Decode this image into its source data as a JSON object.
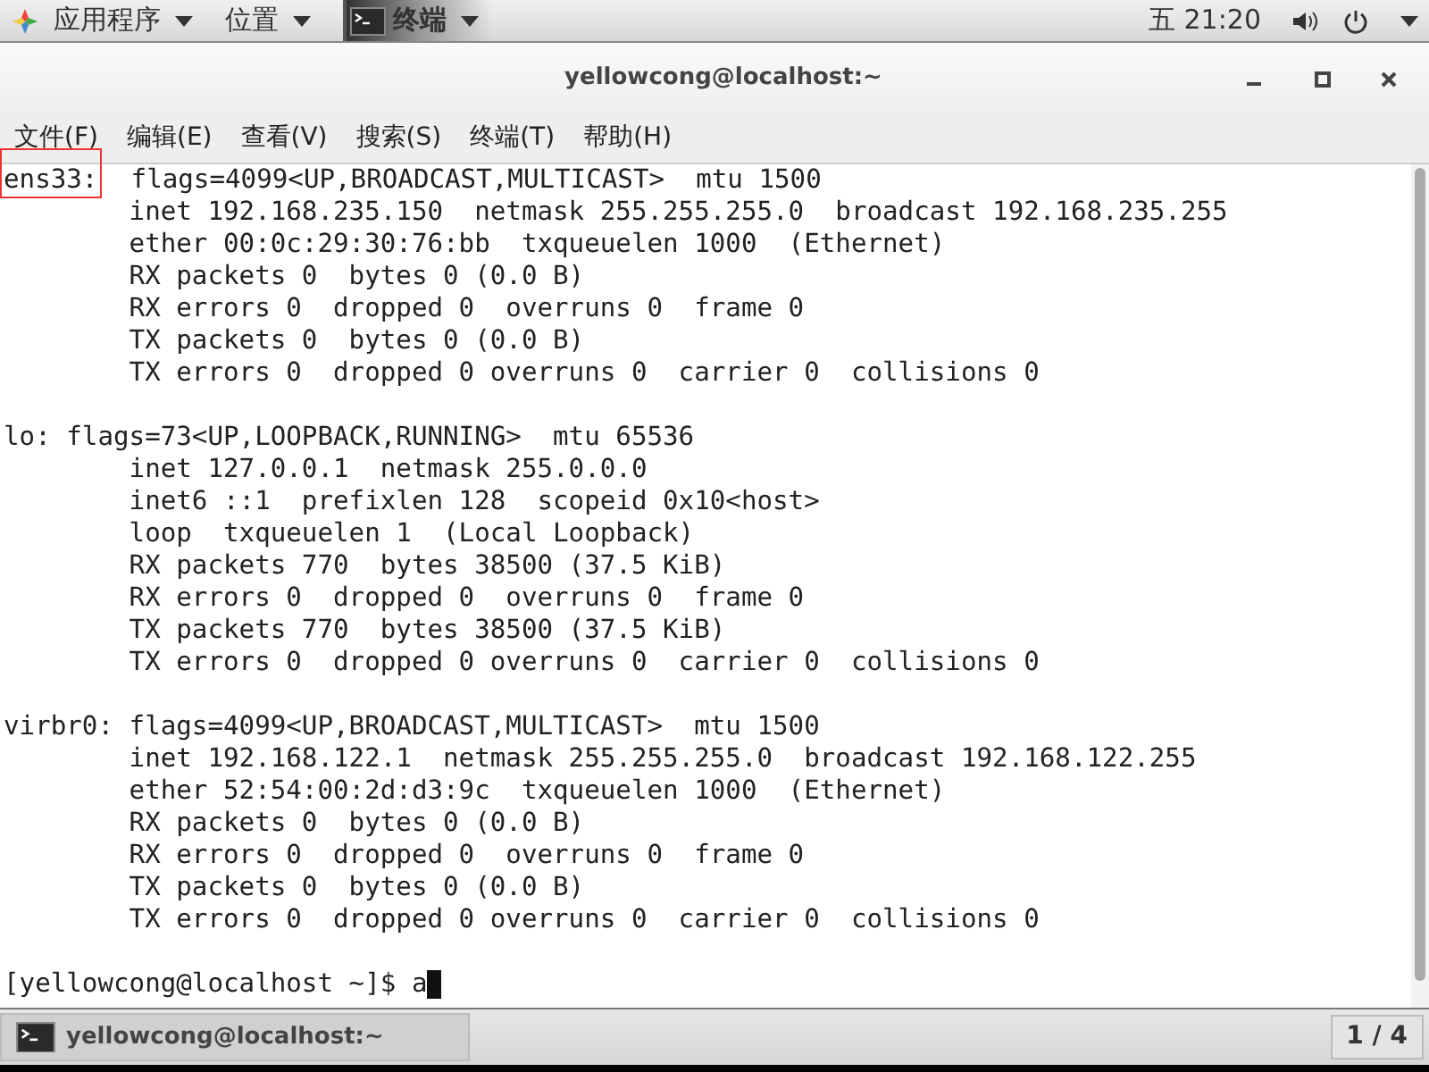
{
  "top_bar": {
    "menus": [
      {
        "label": "应用程序"
      },
      {
        "label": "位置"
      }
    ],
    "active_app": {
      "label": "终端"
    },
    "clock": "五 21:20"
  },
  "window": {
    "title": "yellowcong@localhost:~"
  },
  "menu_bar": [
    "文件(F)",
    "编辑(E)",
    "查看(V)",
    "搜索(S)",
    "终端(T)",
    "帮助(H)"
  ],
  "terminal": {
    "lines": [
      {
        "kind": "text",
        "label": "ens33:",
        "boxed": true,
        "text": "  flags=4099<UP,BROADCAST,MULTICAST>  mtu 1500"
      },
      {
        "kind": "text",
        "text": "        inet 192.168.235.150  netmask 255.255.255.0  broadcast 192.168.235.255"
      },
      {
        "kind": "text",
        "text": "        ether 00:0c:29:30:76:bb  txqueuelen 1000  (Ethernet)"
      },
      {
        "kind": "text",
        "text": "        RX packets 0  bytes 0 (0.0 B)"
      },
      {
        "kind": "text",
        "text": "        RX errors 0  dropped 0  overruns 0  frame 0"
      },
      {
        "kind": "text",
        "text": "        TX packets 0  bytes 0 (0.0 B)"
      },
      {
        "kind": "text",
        "text": "        TX errors 0  dropped 0 overruns 0  carrier 0  collisions 0"
      },
      {
        "kind": "blank"
      },
      {
        "kind": "text",
        "text": "lo: flags=73<UP,LOOPBACK,RUNNING>  mtu 65536"
      },
      {
        "kind": "text",
        "text": "        inet 127.0.0.1  netmask 255.0.0.0"
      },
      {
        "kind": "text",
        "text": "        inet6 ::1  prefixlen 128  scopeid 0x10<host>"
      },
      {
        "kind": "text",
        "text": "        loop  txqueuelen 1  (Local Loopback)"
      },
      {
        "kind": "text",
        "text": "        RX packets 770  bytes 38500 (37.5 KiB)"
      },
      {
        "kind": "text",
        "text": "        RX errors 0  dropped 0  overruns 0  frame 0"
      },
      {
        "kind": "text",
        "text": "        TX packets 770  bytes 38500 (37.5 KiB)"
      },
      {
        "kind": "text",
        "text": "        TX errors 0  dropped 0 overruns 0  carrier 0  collisions 0"
      },
      {
        "kind": "blank"
      },
      {
        "kind": "text",
        "text": "virbr0: flags=4099<UP,BROADCAST,MULTICAST>  mtu 1500"
      },
      {
        "kind": "text",
        "text": "        inet 192.168.122.1  netmask 255.255.255.0  broadcast 192.168.122.255"
      },
      {
        "kind": "text",
        "text": "        ether 52:54:00:2d:d3:9c  txqueuelen 1000  (Ethernet)"
      },
      {
        "kind": "text",
        "text": "        RX packets 0  bytes 0 (0.0 B)"
      },
      {
        "kind": "text",
        "text": "        RX errors 0  dropped 0  overruns 0  frame 0"
      },
      {
        "kind": "text",
        "text": "        TX packets 0  bytes 0 (0.0 B)"
      },
      {
        "kind": "text",
        "text": "        TX errors 0  dropped 0 overruns 0  carrier 0  collisions 0"
      },
      {
        "kind": "blank"
      },
      {
        "kind": "prompt",
        "text": "[yellowcong@localhost ~]$ a",
        "cursor": true
      }
    ]
  },
  "taskbar": {
    "windows": [
      {
        "label": "yellowcong@localhost:~",
        "selected": false
      }
    ],
    "workspace": "1 / 4"
  }
}
